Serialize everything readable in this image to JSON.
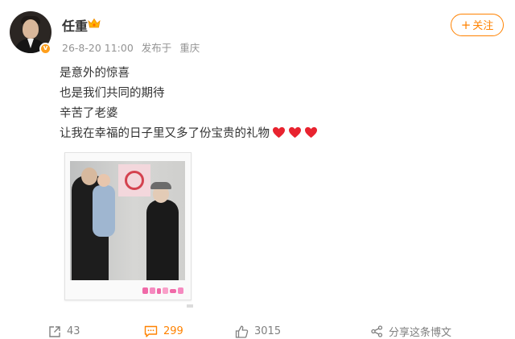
{
  "user": {
    "name": "任重",
    "verified_badge": "v"
  },
  "meta": {
    "time": "26-8-20 11:00",
    "location_prefix": "发布于",
    "location": "重庆"
  },
  "follow_button": {
    "label": "关注"
  },
  "post": {
    "lines": [
      "是意外的惊喜",
      "也是我们共同的期待",
      "辛苦了老婆",
      "让我在幸福的日子里又多了份宝贵的礼物"
    ],
    "emoji": [
      "heart-icon",
      "heart-icon",
      "heart-icon"
    ]
  },
  "actions": {
    "repost_count": "43",
    "comment_count": "299",
    "like_count": "3015",
    "share_label": "分享这条博文"
  },
  "colors": {
    "accent": "#ff8200",
    "text": "#333333",
    "meta": "#939393",
    "heart": "#e8232f"
  }
}
